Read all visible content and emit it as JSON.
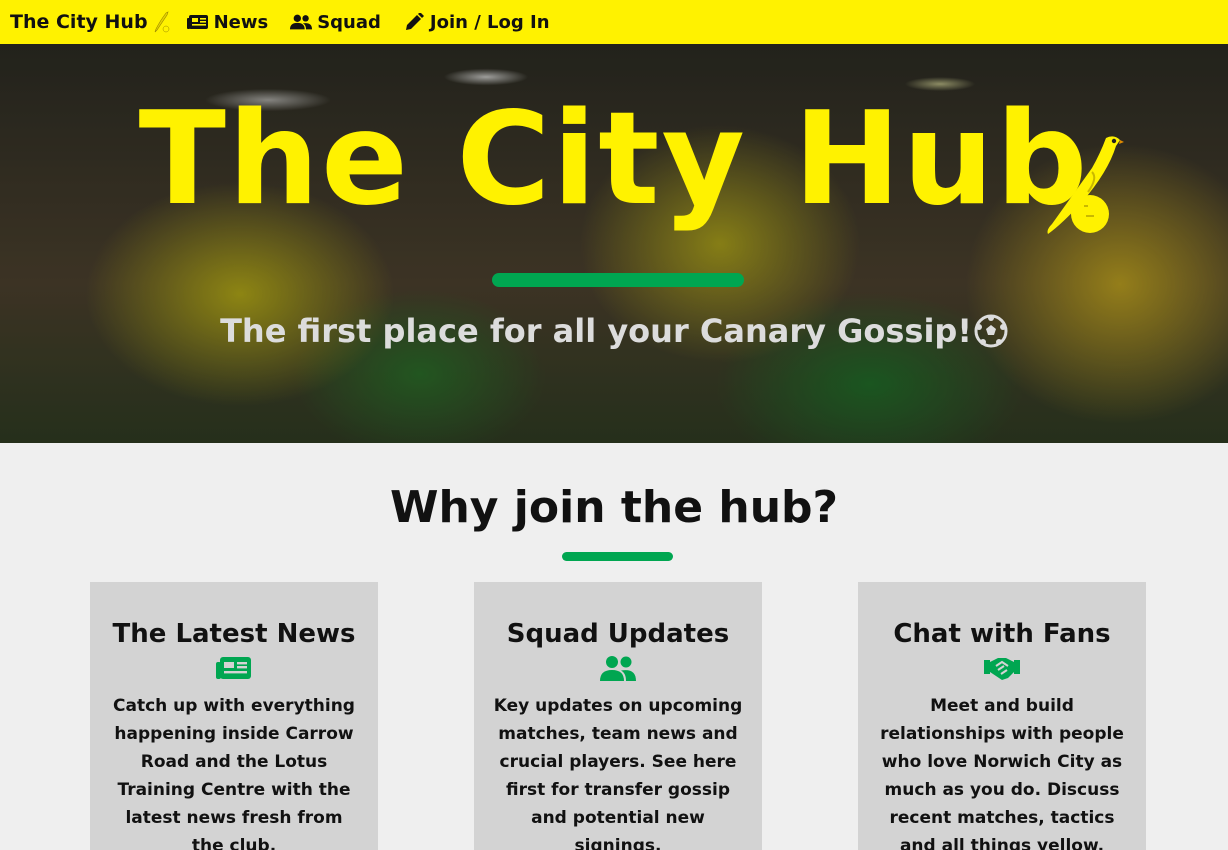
{
  "nav": {
    "brand": "The City Hub",
    "links": [
      {
        "label": "News",
        "icon": "newspaper-icon"
      },
      {
        "label": "Squad",
        "icon": "users-icon"
      },
      {
        "label": "Join / Log In",
        "icon": "pencil-icon"
      }
    ]
  },
  "hero": {
    "title": "The City Hub",
    "subtitle": "The first place for all your Canary Gossip!",
    "icon": "canary-bird-icon"
  },
  "why": {
    "title": "Why join the hub?",
    "cards": [
      {
        "title": "The Latest News",
        "icon": "newspaper-icon",
        "text": "Catch up with everything happening inside Carrow Road and the Lotus Training Centre with the latest news fresh from the club."
      },
      {
        "title": "Squad Updates",
        "icon": "users-icon",
        "text": "Key updates on upcoming matches, team news and crucial players. See here first for transfer gossip and potential new signings."
      },
      {
        "title": "Chat with Fans",
        "icon": "handshake-icon",
        "text": "Meet and build relationships with people who love Norwich City as much as you do. Discuss recent matches, tactics and all things yellow."
      }
    ]
  },
  "colors": {
    "brand_yellow": "#fff200",
    "accent_green": "#00a651",
    "card_bg": "#d3d3d3"
  }
}
